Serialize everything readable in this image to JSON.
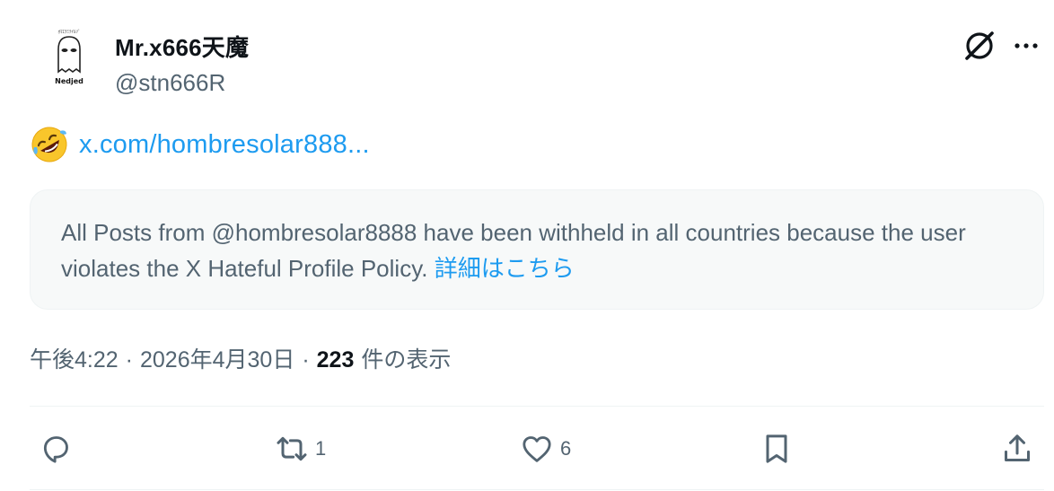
{
  "user": {
    "display_name": "Mr.x666天魔",
    "handle": "@stn666R",
    "avatar_label": "Nedjed"
  },
  "tweet": {
    "emoji": "rolling-on-floor-laughing-emoji",
    "link_text": "x.com/hombresolar888..."
  },
  "notice": {
    "text": "All Posts from @hombresolar8888 have been withheld in all countries because the user violates the X Hateful Profile Policy.",
    "link_text": "詳細はこちら"
  },
  "meta": {
    "time": "午後4:22",
    "separator": "·",
    "date": "2026年4月30日",
    "views_count": "223",
    "views_label": "件の表示"
  },
  "actions": {
    "reply_count": "",
    "repost_count": "1",
    "like_count": "6"
  },
  "icons": {
    "grok": "grok-icon",
    "more": "more-icon",
    "reply": "reply-icon",
    "repost": "repost-icon",
    "like": "heart-icon",
    "bookmark": "bookmark-icon",
    "share": "share-icon"
  },
  "colors": {
    "accent": "#1d9bf0",
    "text": "#0f1419",
    "muted": "#536471",
    "notice_bg": "#f7f9f9"
  }
}
